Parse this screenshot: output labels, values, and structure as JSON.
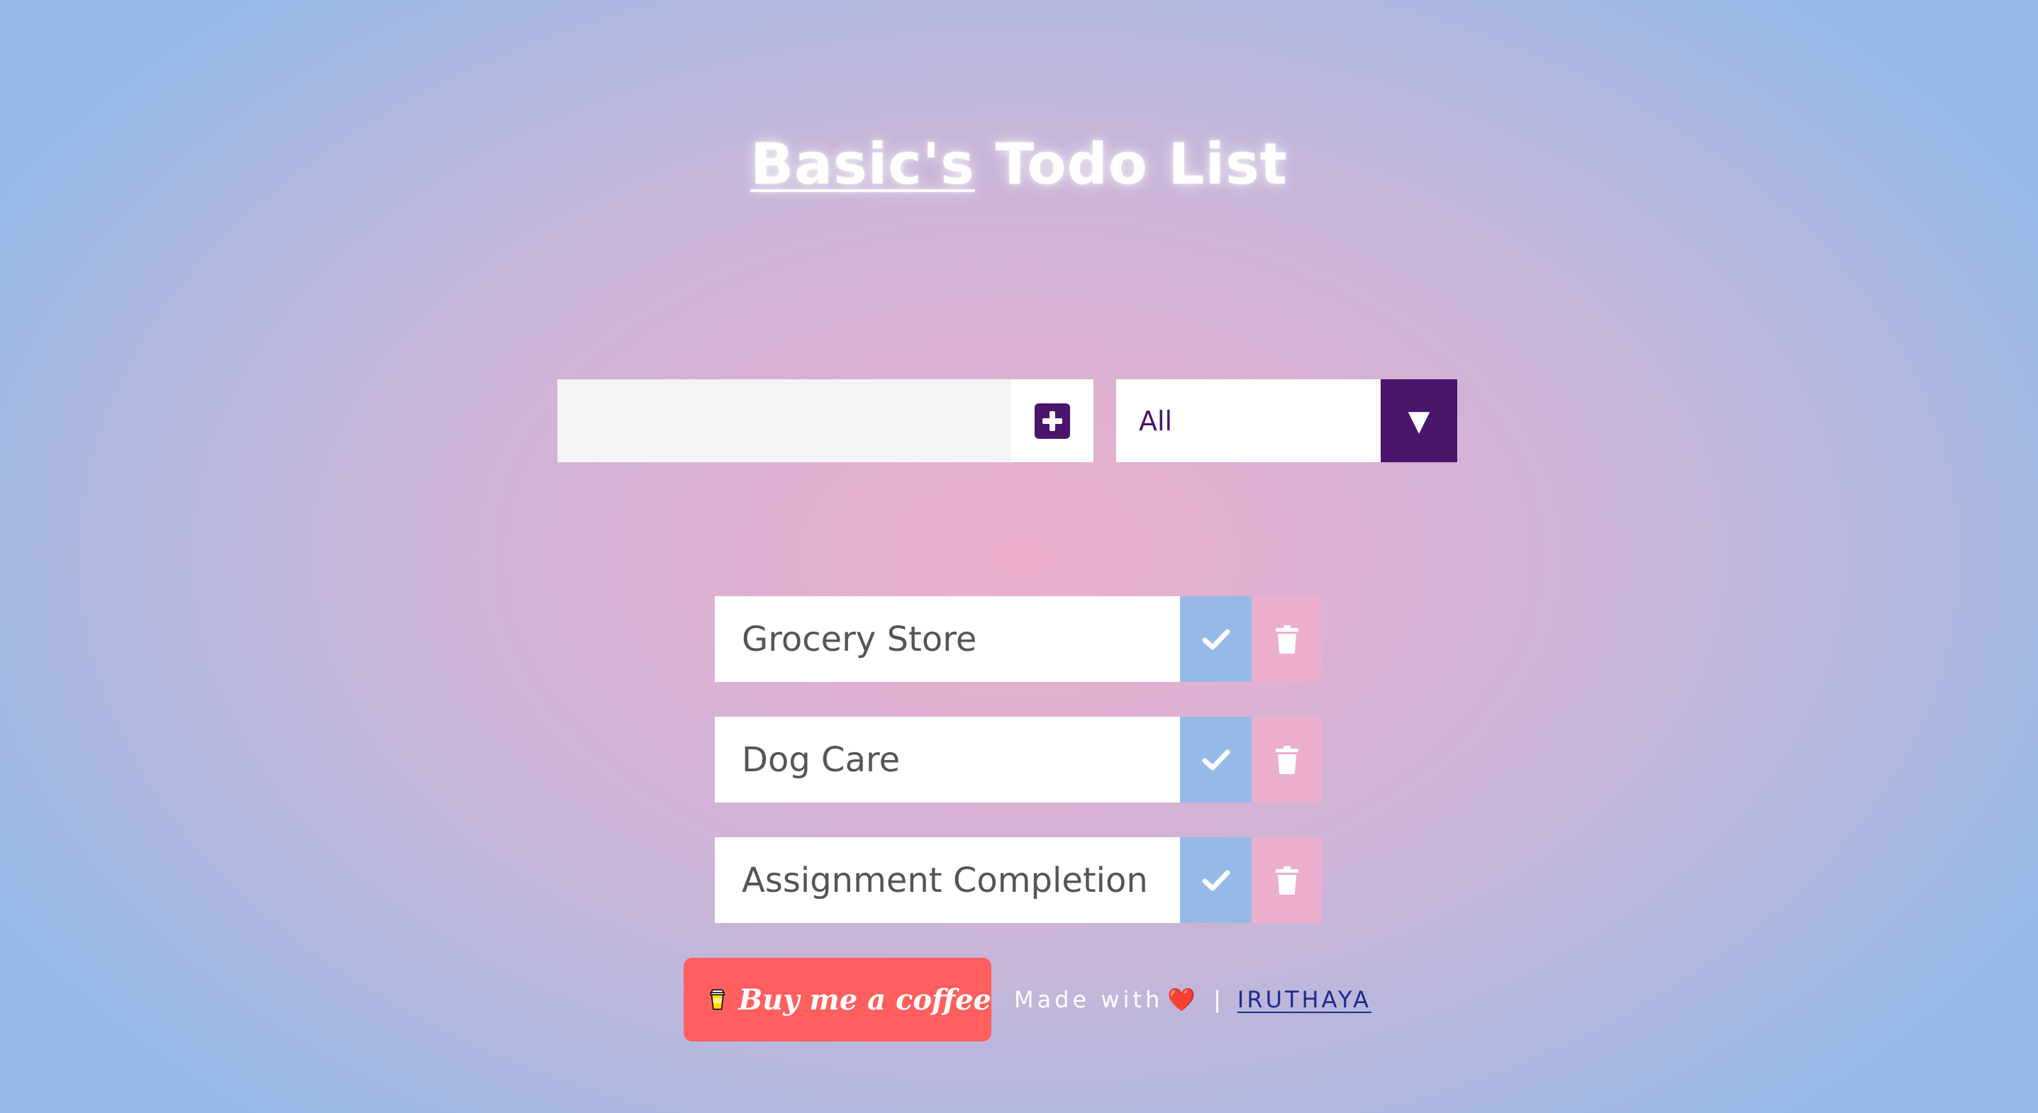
{
  "header": {
    "brand": "Basic's",
    "title_rest": " Todo List"
  },
  "add_form": {
    "input_value": "",
    "add_icon": "plus-square-icon"
  },
  "filter": {
    "selected": "All",
    "arrow_glyph": "▼"
  },
  "todos": [
    {
      "text": "Grocery Store"
    },
    {
      "text": "Dog Care"
    },
    {
      "text": "Assignment Completion"
    }
  ],
  "footer": {
    "coffee_label": "Buy me a coffee",
    "made_with": "Made with",
    "heart": "❤️",
    "separator": "|",
    "author": "IRUTHAYA"
  },
  "colors": {
    "accent": "#4b156b",
    "check": "#96bae8",
    "trash": "#ecaecd",
    "coffee": "#ff5f5f",
    "link": "#1a2d8c"
  }
}
